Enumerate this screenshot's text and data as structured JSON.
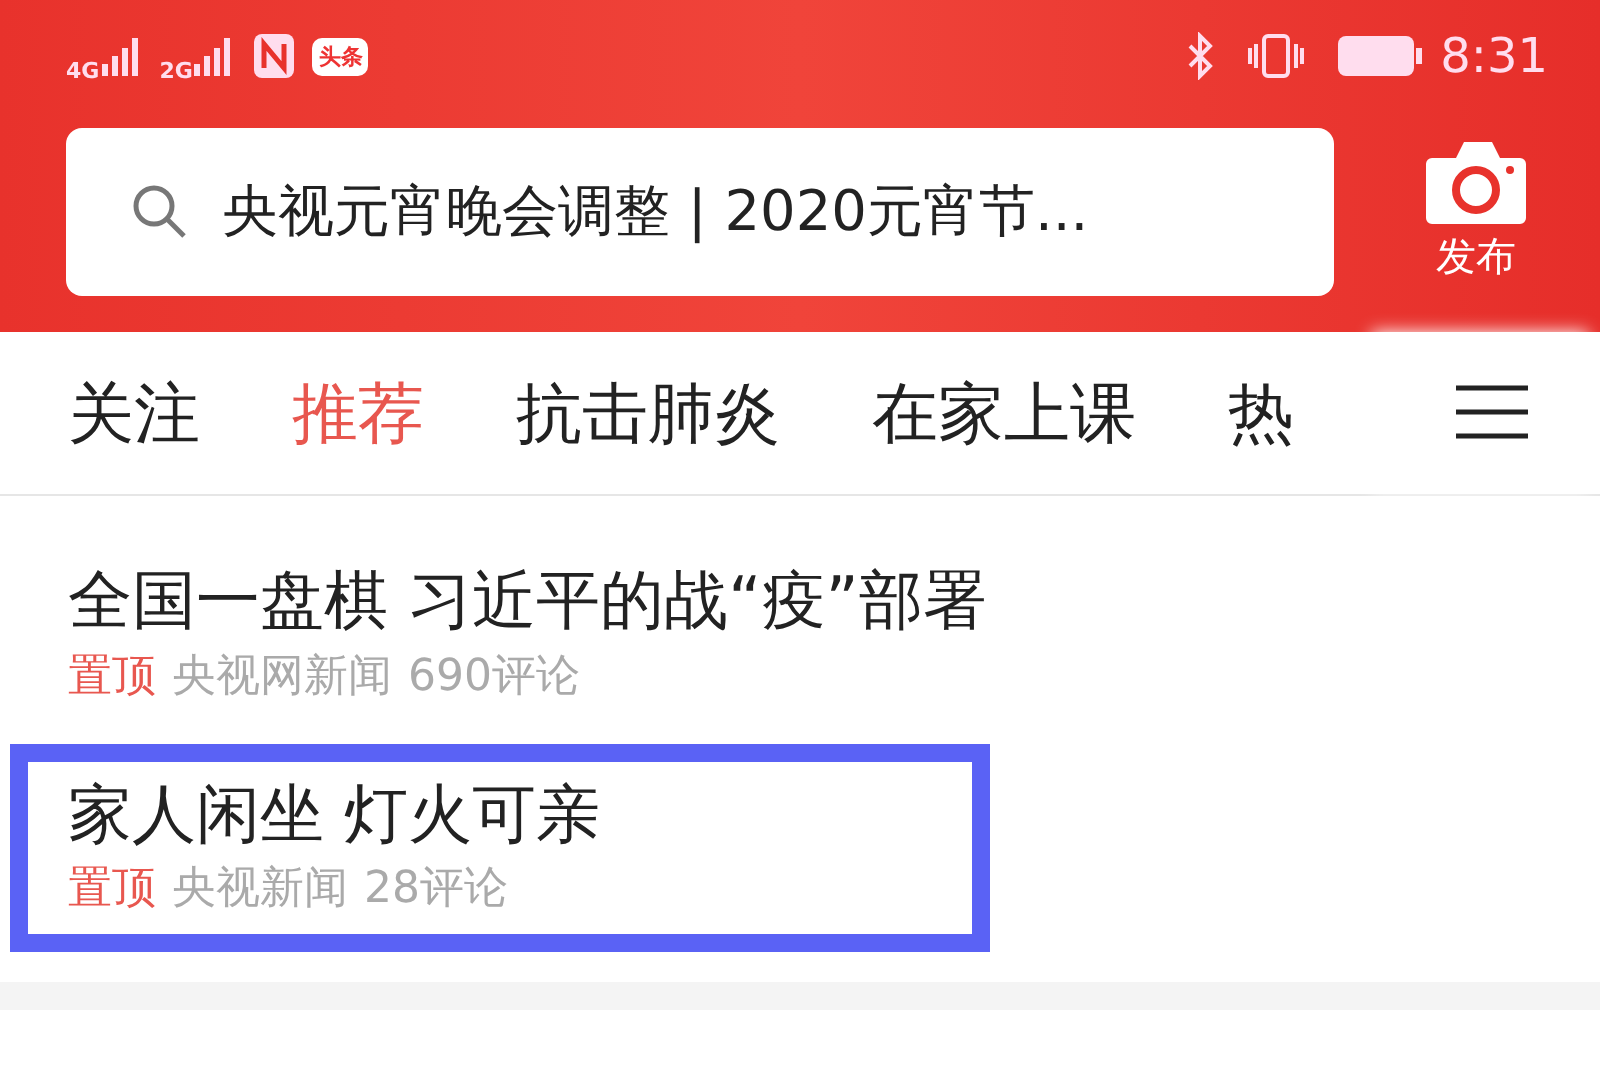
{
  "status_bar": {
    "network_1": "4G",
    "network_2": "2G",
    "app_icon": "头条",
    "time": "8:31"
  },
  "search": {
    "value": "央视元宵晚会调整 | 2020元宵节..."
  },
  "publish_button": {
    "label": "发布"
  },
  "tabs": [
    {
      "label": "关注",
      "selected": false
    },
    {
      "label": "推荐",
      "selected": true
    },
    {
      "label": "抗击肺炎",
      "selected": false
    },
    {
      "label": "在家上课",
      "selected": false
    },
    {
      "label": "热",
      "selected": false
    }
  ],
  "feed": [
    {
      "title": "全国一盘棋 习近平的战“疫”部署",
      "tag": "置顶",
      "source": "央视网新闻",
      "comments": "690评论",
      "highlighted": false
    },
    {
      "title": "家人闲坐 灯火可亲",
      "tag": "置顶",
      "source": "央视新闻",
      "comments": "28评论",
      "highlighted": true
    }
  ]
}
